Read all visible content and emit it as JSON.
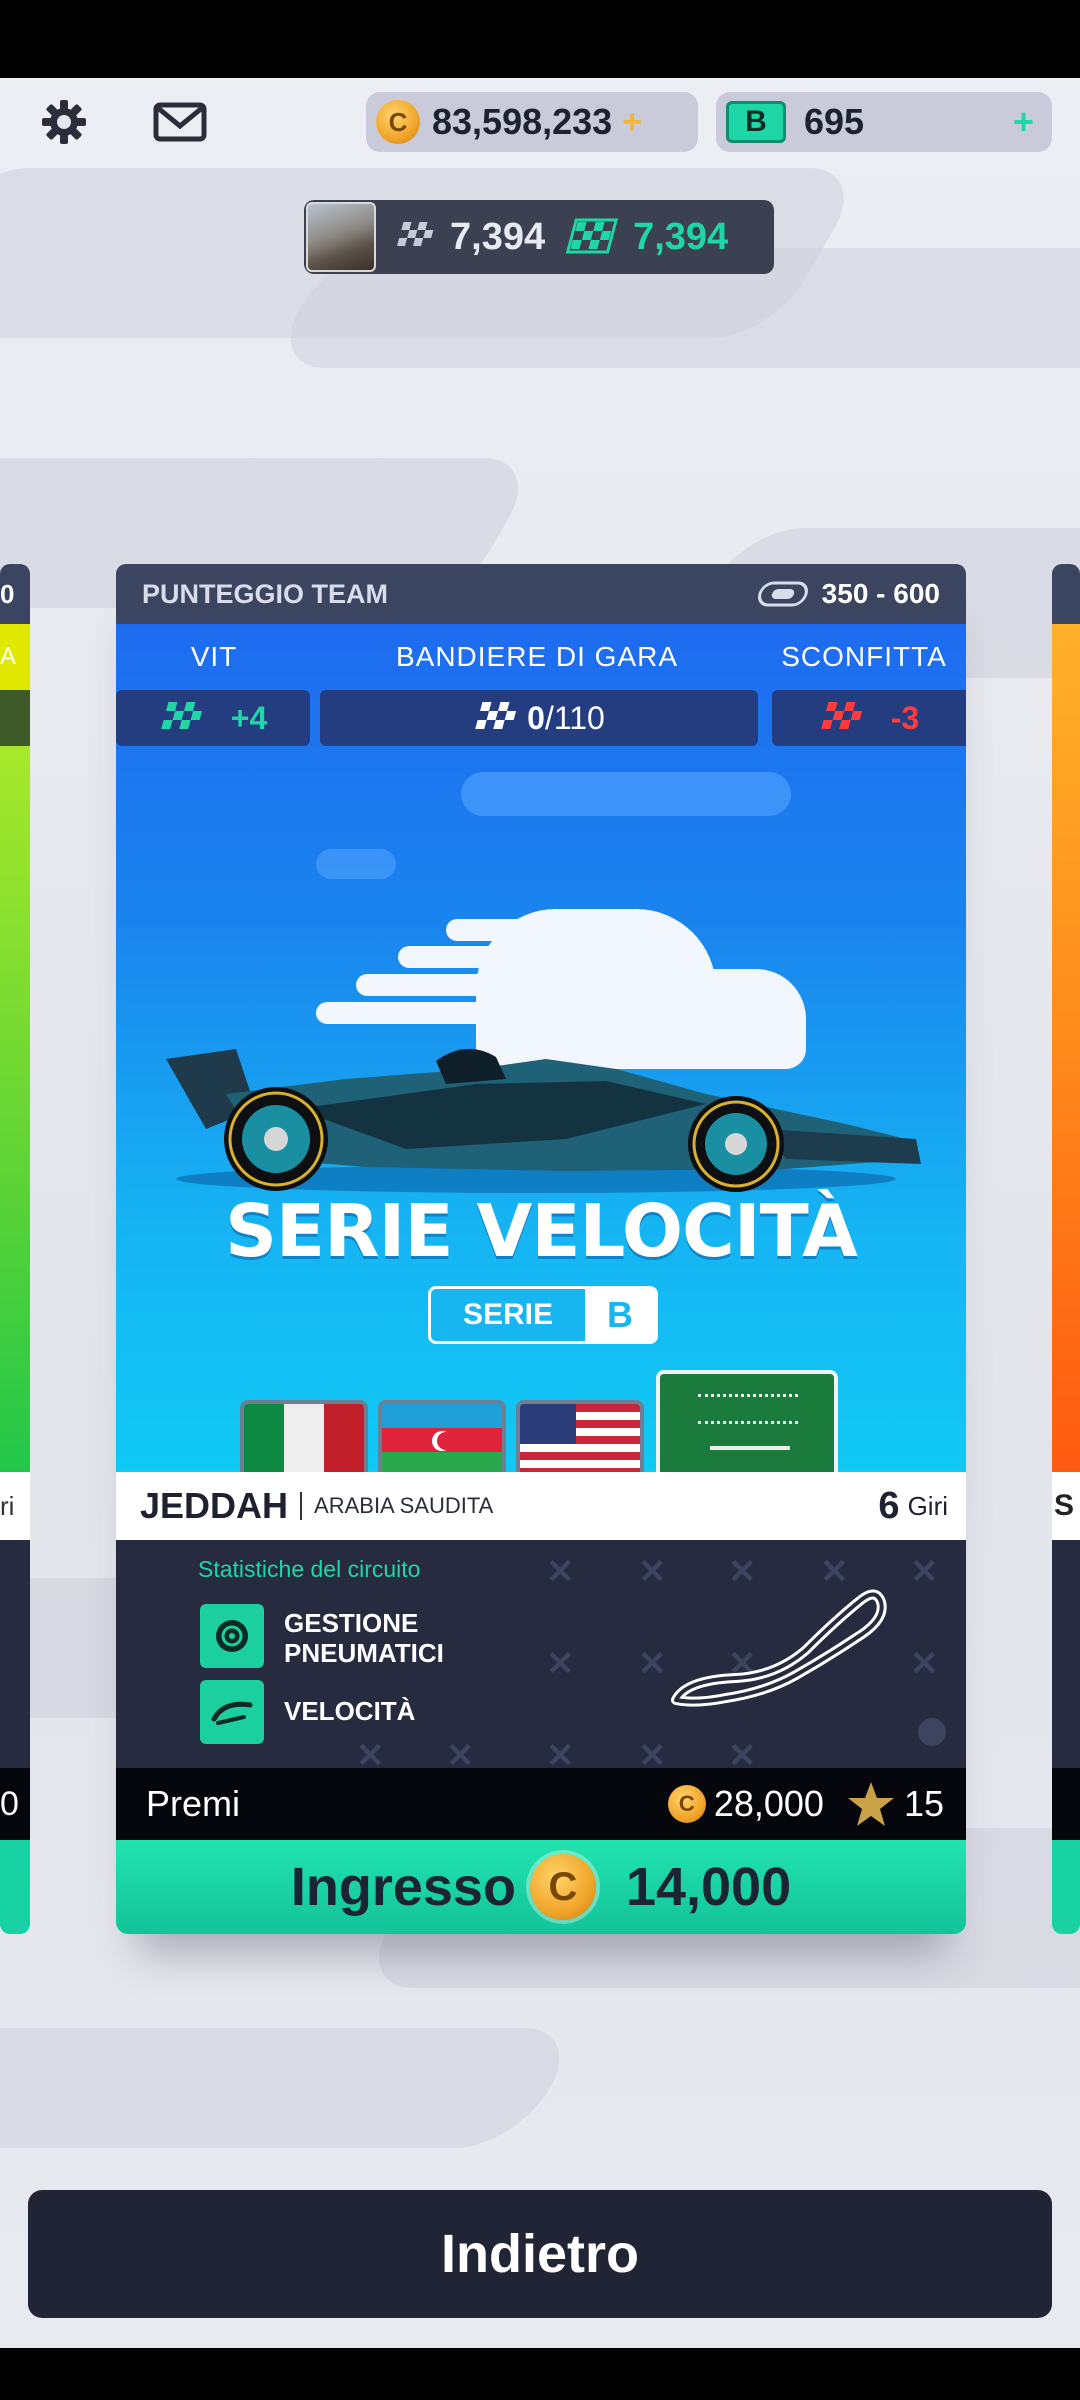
{
  "header": {
    "coins": "83,598,233",
    "coins_add": "+",
    "bucks_label": "B",
    "bucks": "695",
    "bucks_add": "+"
  },
  "profile": {
    "score_a": "7,394",
    "score_b": "7,394"
  },
  "card": {
    "team_score_label": "PUNTEGGIO TEAM",
    "team_score_range": "350 - 600",
    "win_label": "VIT",
    "flags_label": "BANDIERE DI GARA",
    "loss_label": "SCONFITTA",
    "win_value": "+4",
    "flags_value_current": "0",
    "flags_value_total": "/110",
    "loss_value": "-3",
    "title": "SERIE VELOCITÀ",
    "series_label": "SERIE",
    "series_letter": "B",
    "flags": [
      "italy-flag",
      "azerbaijan-flag",
      "usa-flag",
      "saudi-arabia-flag"
    ],
    "circuit_name": "JEDDAH",
    "country": "ARABIA SAUDITA",
    "laps": "6",
    "laps_label": "Giri",
    "stats_title": "Statistiche del circuito",
    "stat_1_line1": "GESTIONE",
    "stat_1_line2": "PNEUMATICI",
    "stat_2": "VELOCITÀ",
    "prizes_label": "Premi",
    "prize_coins": "28,000",
    "prize_stars": "15",
    "entry_label": "Ingresso",
    "entry_cost": "14,000"
  },
  "left_card": {
    "partial_a": "0",
    "partial_b": "A",
    "partial_c": "ri",
    "partial_d": "0"
  },
  "right_card": {
    "partial_a": "S"
  },
  "footer": {
    "back_label": "Indietro"
  },
  "colors": {
    "accent_green": "#1fd6a6",
    "card_blue": "#1a84ee",
    "loss_red": "#ff3b3b",
    "coin_gold": "#f1a52a"
  }
}
